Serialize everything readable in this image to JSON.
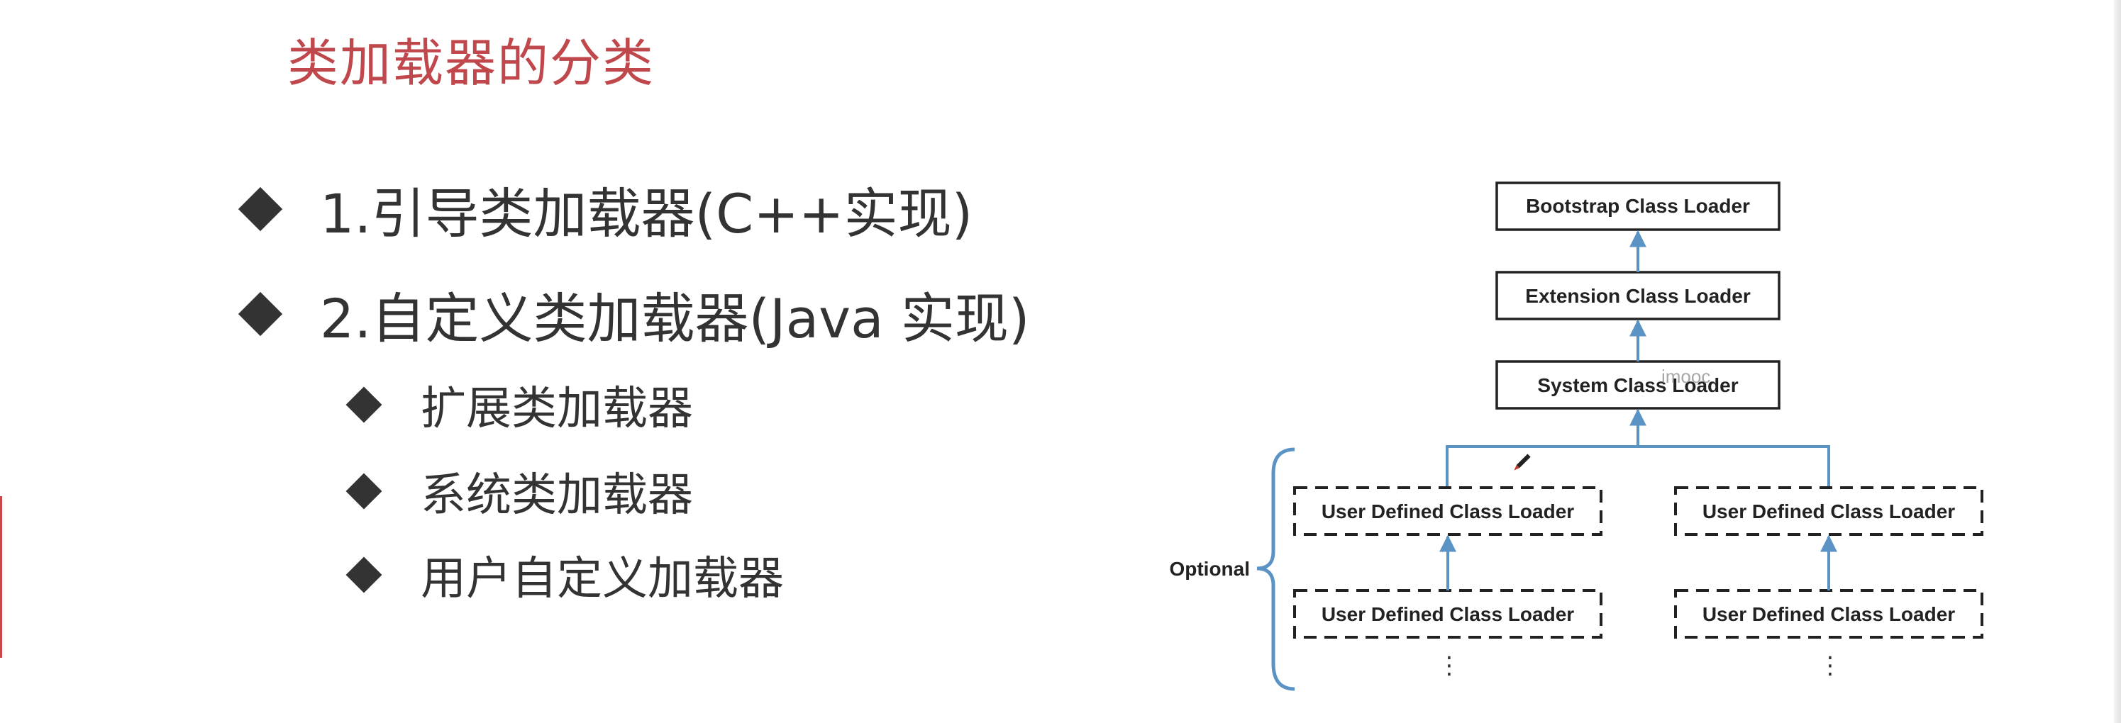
{
  "slide": {
    "title": "类加载器的分类",
    "bullets": [
      "1.引导类加载器(C++实现)",
      "2.自定义类加载器(Java 实现)"
    ],
    "sub_bullets": [
      "扩展类加载器",
      "系统类加载器",
      "用户自定义加载器"
    ]
  },
  "diagram": {
    "boxes": {
      "bootstrap": "Bootstrap Class Loader",
      "extension": "Extension Class Loader",
      "system": "System Class Loader",
      "user_defined": "User Defined Class Loader"
    },
    "optional_label": "Optional",
    "ellipsis": "⋮",
    "watermark": "imooc",
    "colors": {
      "arrow": "#5b94c4",
      "box_border": "#222222",
      "bracket": "#5b94c4"
    }
  }
}
